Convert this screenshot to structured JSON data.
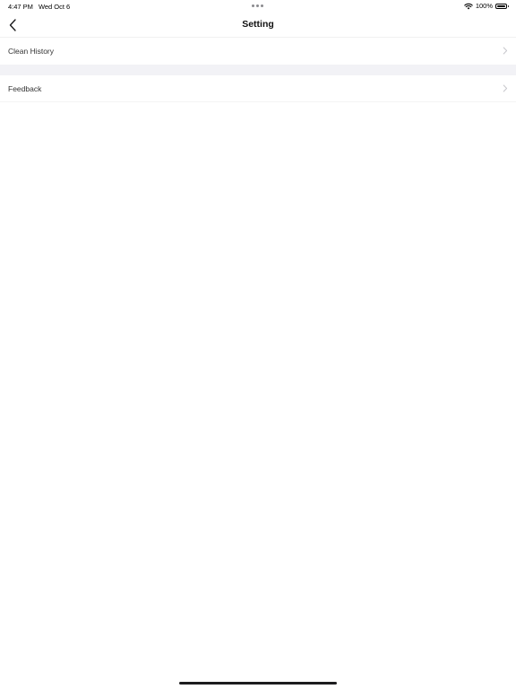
{
  "status_bar": {
    "time": "4:47 PM",
    "date": "Wed Oct 6",
    "battery_percent": "100%",
    "battery_level": 1.0
  },
  "nav": {
    "title": "Setting",
    "back_icon": "chevron-left-icon"
  },
  "settings": {
    "items": [
      {
        "label": "Clean History",
        "icon": "chevron-right-icon"
      },
      {
        "label": "Feedback",
        "icon": "chevron-right-icon"
      }
    ]
  },
  "colors": {
    "background": "#ffffff",
    "section_gap": "#f2f2f6",
    "chevron": "#c7c7cc",
    "text": "#333333"
  }
}
